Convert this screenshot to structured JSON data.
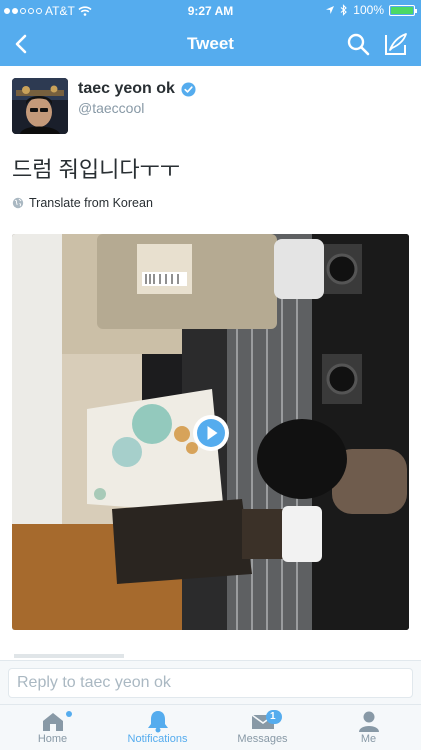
{
  "status_bar": {
    "carrier": "AT&T",
    "time": "9:27 AM",
    "battery": "100%"
  },
  "nav": {
    "title": "Tweet",
    "icons": [
      "back-chevron-icon",
      "search-icon",
      "compose-icon"
    ]
  },
  "tweet": {
    "author_name": "taec yeon ok",
    "handle": "@taeccool",
    "verified": true,
    "text": "드럼 줘입니다ㅜㅜ",
    "translate_label": "Translate from Korean",
    "media_type": "video"
  },
  "reply": {
    "placeholder": "Reply to taec yeon ok"
  },
  "tabbar": {
    "home": "Home",
    "notifications": "Notifications",
    "messages": "Messages",
    "messages_badge": "1",
    "me": "Me"
  },
  "colors": {
    "brand": "#55acee",
    "battery": "#4cd964",
    "muted": "#8899a6"
  }
}
